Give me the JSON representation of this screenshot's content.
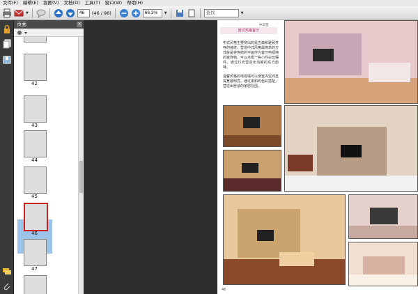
{
  "menu": {
    "items": [
      "文件(F)",
      "编辑(E)",
      "视图(V)",
      "文档(D)",
      "工具(T)",
      "窗口(W)",
      "帮助(H)"
    ]
  },
  "toolbar": {
    "current_page": "46",
    "page_total": "(46 / 98)",
    "zoom": "66.3%",
    "search_placeholder": "查找"
  },
  "icons": {
    "print": "print-icon",
    "mail": "mail-icon",
    "up": "arrow-up-icon",
    "down": "arrow-down-icon",
    "zoom_out": "zoom-out-icon",
    "zoom_in": "zoom-in-icon",
    "save": "save-icon"
  },
  "panel": {
    "title": "页面",
    "close": "×"
  },
  "thumbnails": {
    "labels": [
      "42",
      "43",
      "44",
      "45",
      "46",
      "47"
    ],
    "selected": "46"
  },
  "page": {
    "tag": "中华室",
    "title": "欧式风格客厅",
    "paragraphs": [
      "中式风格主要突出的是古典和雅致并存的装修，营造中式风格最简单的方式就是将传统的字画作为客厅电视墙的装饰物，可以点缀一些小件古玩摆件，通过灯光营造出浓郁的东方韵味。",
      "温馨风格的电视墙可以使室内空间显得宽敞明亮，通过柔和的色彩搭配，营造出舒适的家居氛围。"
    ],
    "number": "46"
  },
  "colors": {
    "accent": "#b02a6a",
    "selection": "#9cc4e8"
  }
}
